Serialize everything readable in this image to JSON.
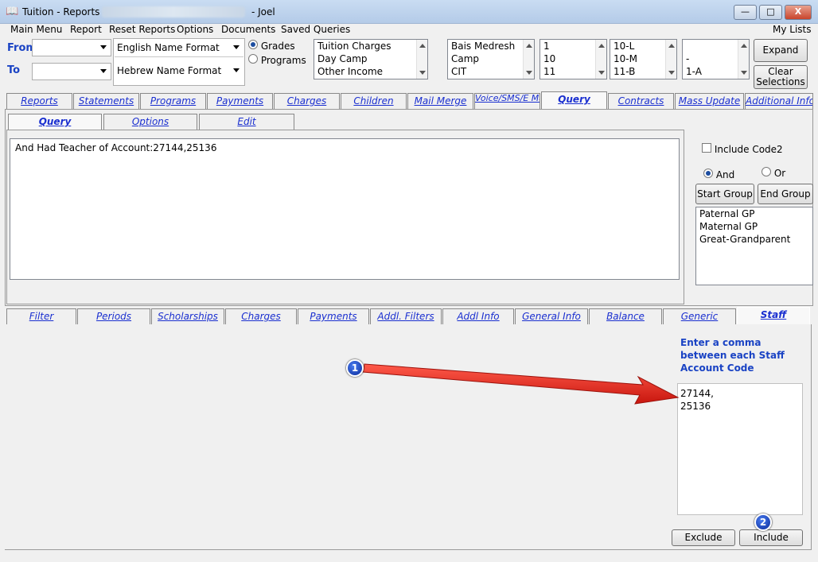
{
  "window": {
    "title": "Tuition - Reports -",
    "user": "- Joel",
    "min_label": "—",
    "max_label": "□",
    "close_label": "X"
  },
  "menu": [
    "Main Menu",
    "Report",
    "Reset Reports",
    "Options",
    "Documents",
    "Saved Queries"
  ],
  "my_lists": "My Lists",
  "from_label": "From",
  "to_label": "To",
  "from_value": "",
  "to_value": "",
  "name_format_english": "English Name Format",
  "name_format_hebrew": "Hebrew Name Format",
  "radio_grades": "Grades",
  "radio_programs": "Programs",
  "list_charges": [
    "Tuition Charges",
    "Day Camp",
    "Other Income"
  ],
  "list_schools": [
    "Bais Medresh",
    "Camp",
    "CIT"
  ],
  "list_grades": [
    "1",
    "10",
    "11"
  ],
  "list_classes": [
    "10-L",
    "10-M",
    "11-B"
  ],
  "list_misc": [
    "-",
    "1-A"
  ],
  "expand_label": "Expand",
  "clear_label": "Clear Selections",
  "top_tabs": [
    "Reports",
    "Statements",
    "Programs",
    "Payments",
    "Charges",
    "Children",
    "Mail Merge",
    "Voice/SMS/E Mail",
    "Query",
    "Contracts",
    "Mass Update",
    "Additional Info"
  ],
  "sub_tabs": [
    "Query",
    "Options",
    "Edit"
  ],
  "query_text": "And  Had Teacher of Account:27144,25136",
  "include_code2": "Include Code2",
  "and_label": "And",
  "or_label": "Or",
  "start_group": "Start Group",
  "end_group": "End Group",
  "groups_list": [
    "Paternal GP",
    "Maternal GP",
    "Great-Grandparent"
  ],
  "filter_tabs": [
    "Filter",
    "Periods",
    "Scholarships",
    "Charges",
    "Payments",
    "Addl. Filters",
    "Addl Info",
    "General Info",
    "Balance",
    "Generic",
    "Staff"
  ],
  "staff_instructions": "Enter a comma between each Staff Account Code",
  "staff_codes_line1": "27144,",
  "staff_codes_line2": "25136",
  "exclude_label": "Exclude",
  "include_label": "Include",
  "badge1": "1",
  "badge2": "2",
  "colors": {
    "link_blue": "#1a2fd0",
    "instruction_blue": "#1a43c4",
    "arrow_red": "#e8221a"
  }
}
